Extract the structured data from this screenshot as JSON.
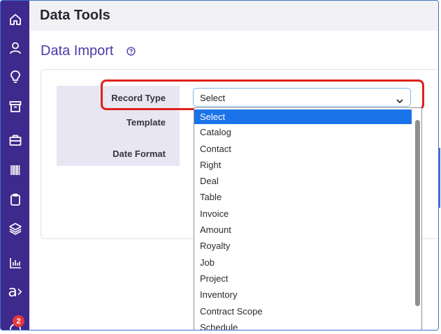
{
  "header": {
    "title": "Data Tools"
  },
  "section": {
    "title": "Data Import"
  },
  "sidebar": {
    "items": [
      {
        "icon": "home-icon"
      },
      {
        "icon": "user-icon"
      },
      {
        "icon": "lightbulb-icon"
      },
      {
        "icon": "archive-icon"
      },
      {
        "icon": "briefcase-icon"
      },
      {
        "icon": "barcode-icon"
      },
      {
        "icon": "clipboard-icon"
      },
      {
        "icon": "layers-icon"
      },
      {
        "icon": "bar-chart-icon"
      },
      {
        "icon": "brand-logo",
        "label": "a›"
      }
    ],
    "notification_badge": "2",
    "accent": "#3d2a8c"
  },
  "form": {
    "record_type_label": "Record Type",
    "template_label": "Template",
    "date_format_label": "Date Format",
    "record_type_value": "Select"
  },
  "dropdown": {
    "options": [
      "Select",
      "Catalog",
      "Contact",
      "Right",
      "Deal",
      "Table",
      "Invoice",
      "Amount",
      "Royalty",
      "Job",
      "Project",
      "Inventory",
      "Contract Scope",
      "Schedule"
    ],
    "selected": "Select",
    "selected_color": "#1a73e8"
  },
  "highlight_color": "#e0201b"
}
